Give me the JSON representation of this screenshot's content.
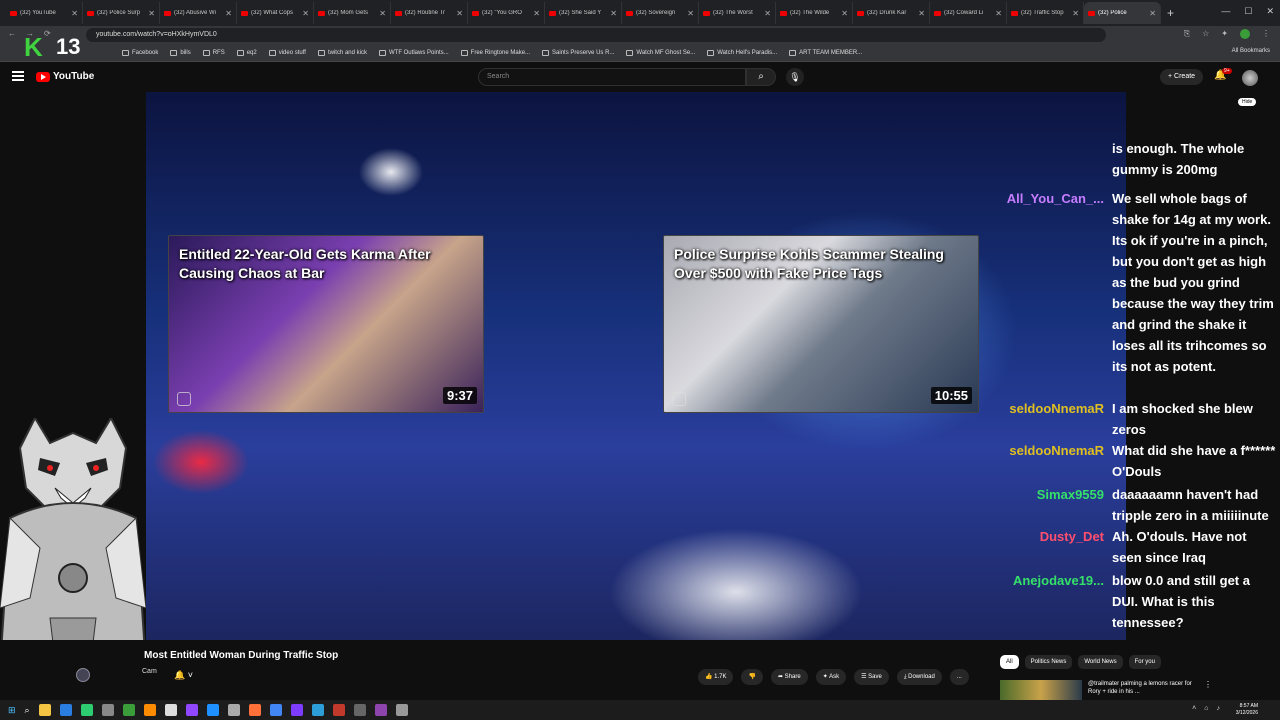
{
  "browser": {
    "tabs": [
      {
        "title": "(32) YouTube",
        "active": false
      },
      {
        "title": "(32) Police Surp",
        "active": false
      },
      {
        "title": "(32) Abusive Wi",
        "active": false
      },
      {
        "title": "(32) What Cops",
        "active": false
      },
      {
        "title": "(32) Mom Gets",
        "active": false
      },
      {
        "title": "(32) Routine Tr",
        "active": false
      },
      {
        "title": "(32) \"You GRO",
        "active": false
      },
      {
        "title": "(32) She Said Y",
        "active": false
      },
      {
        "title": "(32) Sovereign",
        "active": false
      },
      {
        "title": "(32) The Worst",
        "active": false
      },
      {
        "title": "(32) The Wilde",
        "active": false
      },
      {
        "title": "(32) Drunk Kar",
        "active": false
      },
      {
        "title": "(32) Coward Li",
        "active": false
      },
      {
        "title": "(32) Traffic Stop",
        "active": false
      },
      {
        "title": "(32) Police",
        "active": true
      }
    ],
    "url": "youtube.com/watch?v=oHXkHymVDL0",
    "bookmarks": [
      "Facebook",
      "bills",
      "RFS",
      "eq2",
      "video stuff",
      "twitch and kick",
      "WTF Outlaws Points...",
      "Free Ringtone Make...",
      "Saints Preserve Us R...",
      "Watch MF Ghost Se...",
      "Watch Hell's Paradis...",
      "ART TEAM MEMBER..."
    ],
    "all_bookmarks": "All Bookmarks"
  },
  "overlay": {
    "logo_letter": "K",
    "logo_number": "13"
  },
  "youtube": {
    "brand": "YouTube",
    "search_placeholder": "Search",
    "create_label": "Create",
    "notif_count": "9+"
  },
  "endcards": [
    {
      "title": "Entitled 22-Year-Old Gets Karma After Causing Chaos at Bar",
      "duration": "9:37"
    },
    {
      "title": "Police Surprise Kohls Scammer Stealing Over $500 with Fake Price Tags",
      "duration": "10:55"
    }
  ],
  "chat": {
    "hide_label": "Hide",
    "messages": [
      {
        "user": "",
        "color": "#ffffff",
        "text": "is enough. The whole gummy is 200mg"
      },
      {
        "user": "All_You_Can_...",
        "color": "#c77dff",
        "text": "We sell whole bags of shake for 14g at my work. Its ok if you're in a pinch, but you don't get as high as the bud you grind because the way they trim and grind the shake it loses all its trihcomes so its not as potent."
      },
      {
        "user": "seldooNnemaR",
        "color": "#e0c020",
        "text": "I am shocked she blew zeros"
      },
      {
        "user": "seldooNnemaR",
        "color": "#e0c020",
        "text": "What did she have a f****** O'Douls"
      },
      {
        "user": "Simax9559",
        "color": "#35e06a",
        "text": "daaaaaamn haven't had tripple zero in a miiiiinute"
      },
      {
        "user": "Dusty_Det",
        "color": "#ff4f6e",
        "text": "Ah. O'douls. Have not seen since Iraq"
      },
      {
        "user": "Anejodave19...",
        "color": "#35e06a",
        "text": "blow 0.0 and still get a DUI. What is this tennessee?"
      }
    ]
  },
  "video_info": {
    "title": "Most Entitled Woman During Traffic Stop",
    "channel": "Cam",
    "likes": "1.7K",
    "share": "Share",
    "ask": "Ask",
    "save": "Save",
    "download": "Download",
    "more": "..."
  },
  "chips": [
    "All",
    "Politics News",
    "World News",
    "For you"
  ],
  "recommended": {
    "title": "@trailmater palming a lemons racer for Rory + ride in his ..."
  },
  "taskbar": {
    "time": "8:57 AM",
    "date": "3/12/2026"
  }
}
